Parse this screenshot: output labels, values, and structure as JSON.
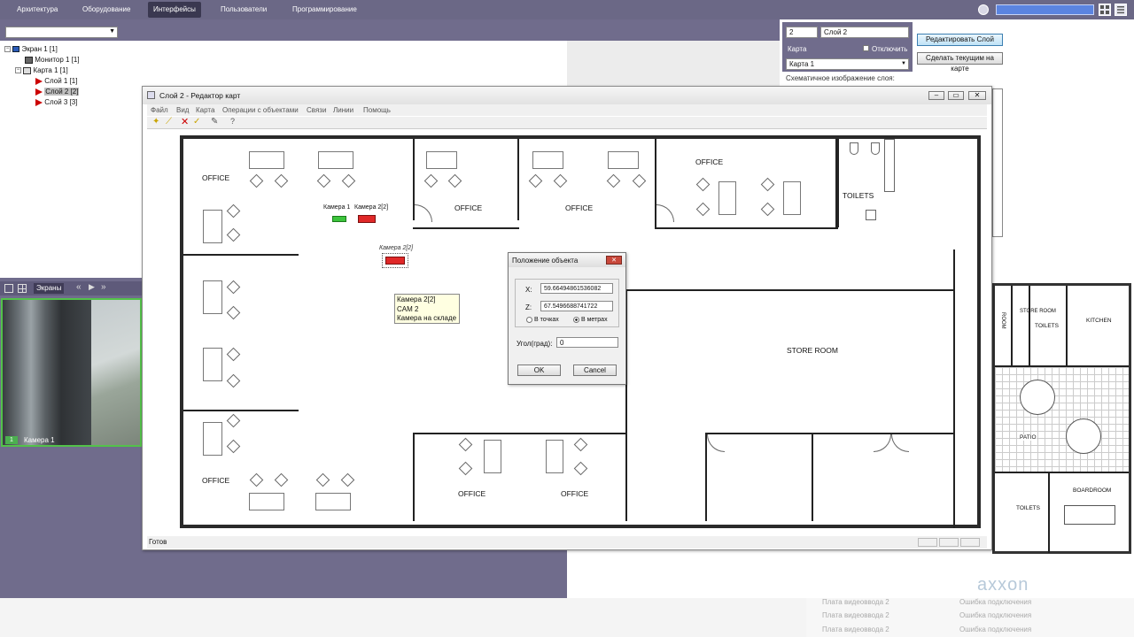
{
  "nav": {
    "tabs": [
      "Архитектура",
      "Оборудование",
      "Интерфейсы",
      "Пользователи",
      "Программирование"
    ],
    "active": "Интерфейсы"
  },
  "tree": {
    "items": [
      "Экран 1 [1]",
      "Монитор 1 [1]",
      "Карта 1 [1]",
      "Слой 1 [1]",
      "Слой 2 [2]",
      "Слой 3 [3]"
    ]
  },
  "props": {
    "id_value": "2",
    "name_value": "Слой 2",
    "map_label": "Карта",
    "disable_label": "Отключить",
    "map_select": "Карта 1",
    "schematic_label": "Схематичное изображение слоя:",
    "edit_layer_button": "Редактировать Слой",
    "make_current_button": "Сделать текущим на карте"
  },
  "screens_bar": {
    "screens_label": "Экраны"
  },
  "camera_view": {
    "number": "1",
    "label": "Камера 1"
  },
  "map_editor": {
    "title": "Слой 2 - Редактор карт",
    "menu": [
      "Файл",
      "Вид",
      "Карта",
      "Операции с объектами",
      "Связи",
      "Линии",
      "Помощь"
    ],
    "status": "Готов",
    "rooms": [
      "OFFICE",
      "OFFICE",
      "OFFICE",
      "OFFICE",
      "TOILETS",
      "OFFICE",
      "OFFICE",
      "OFFICE",
      "STORE ROOM"
    ],
    "cameras": {
      "cam1_label": "Камера 1",
      "cam2_label": "Камера 2[2]",
      "cam2b_label": "Камера 2[2]"
    },
    "tooltip": [
      "Камера 2[2]",
      "CAM 2",
      "Камера на складе"
    ]
  },
  "position_dialog": {
    "title": "Положение объекта",
    "x_label": "X:",
    "x_value": "59.66494861536082",
    "z_label": "Z:",
    "z_value": "67.5496688741722",
    "radio_points": "В точках",
    "radio_meters": "В метрах",
    "angle_label": "Угол(град):",
    "angle_value": "0",
    "ok": "OK",
    "cancel": "Cancel"
  },
  "right_plan": {
    "rooms": [
      "ROOM",
      "STORE ROOM",
      "TOILETS",
      "KITCHEN",
      "PATIO",
      "TOILETS",
      "BOARDROOM"
    ]
  },
  "logo": "axxon",
  "log": {
    "rows": [
      {
        "device": "Плата видеоввода 2",
        "status": "Ошибка подключения"
      },
      {
        "device": "Плата видеоввода 2",
        "status": "Ошибка подключения"
      },
      {
        "device": "Плата видеоввода 2",
        "status": "Ошибка подключения"
      }
    ]
  }
}
